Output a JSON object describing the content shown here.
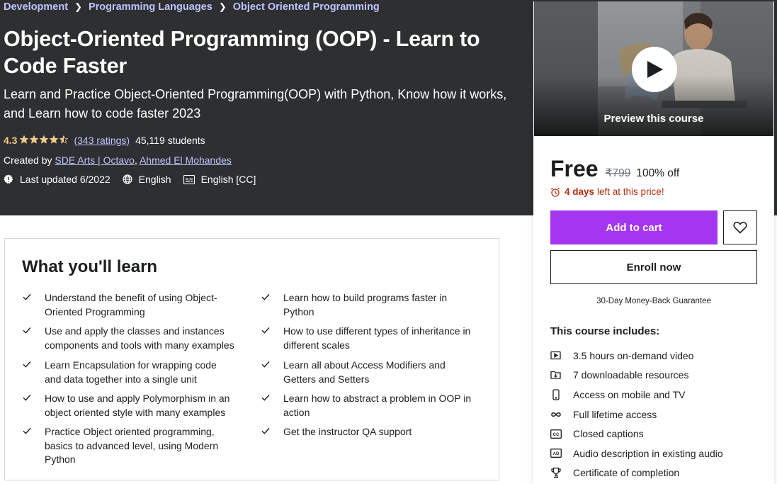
{
  "breadcrumb": [
    {
      "label": "Development"
    },
    {
      "label": "Programming Languages"
    },
    {
      "label": "Object Oriented Programming"
    }
  ],
  "course": {
    "title": "Object-Oriented Programming (OOP) - Learn to Code Faster",
    "subtitle": "Learn and Practice Object-Oriented Programming(OOP) with Python, Know how it works, and Learn how to code faster 2023",
    "rating": "4.3",
    "rating_stars": 4.3,
    "ratings_count": "(343 ratings)",
    "students": "45,119 students",
    "created_by_label": "Created by",
    "authors": [
      "SDE Arts | Octavo",
      "Ahmed El Mohandes"
    ],
    "author_separator": ", ",
    "last_updated": "Last updated 6/2022",
    "language": "English",
    "captions": "English [CC]"
  },
  "learn": {
    "title": "What you'll learn",
    "left": [
      "Understand the benefit of using Object-Oriented Programming",
      "Use and apply the classes and instances components and tools with many examples",
      "Learn Encapsulation for wrapping code and data together into a single unit",
      "How to use and apply Polymorphism in an object oriented style with many examples",
      "Practice Object oriented programming, basics to advanced level, using Modern Python"
    ],
    "right": [
      "Learn how to build programs faster in Python",
      "How to use different types of inheritance in different scales",
      "Learn all about Access Modifiers and Getters and Setters",
      "Learn how to abstract a problem in OOP in action",
      "Get the instructor QA support"
    ]
  },
  "sidebar": {
    "preview_label": "Preview this course",
    "price": "Free",
    "original_price": "₹799",
    "discount": "100% off",
    "timer_bold": "4 days",
    "timer_rest": "left at this price!",
    "add_to_cart": "Add to cart",
    "enroll_now": "Enroll now",
    "guarantee": "30-Day Money-Back Guarantee",
    "includes_title": "This course includes:",
    "includes": [
      {
        "icon": "video-icon",
        "label": "3.5 hours on-demand video"
      },
      {
        "icon": "download-icon",
        "label": "7 downloadable resources"
      },
      {
        "icon": "mobile-icon",
        "label": "Access on mobile and TV"
      },
      {
        "icon": "infinity-icon",
        "label": "Full lifetime access"
      },
      {
        "icon": "closed-captions-icon",
        "label": "Closed captions"
      },
      {
        "icon": "audio-description-icon",
        "label": "Audio description in existing audio"
      },
      {
        "icon": "trophy-icon",
        "label": "Certificate of completion"
      }
    ]
  },
  "colors": {
    "hero_bg": "#2d2f31",
    "link_purple": "#c0c4fc",
    "star_gold": "#f3ca8c",
    "cta_purple": "#a435f0",
    "timer_red": "#b32d0f"
  }
}
